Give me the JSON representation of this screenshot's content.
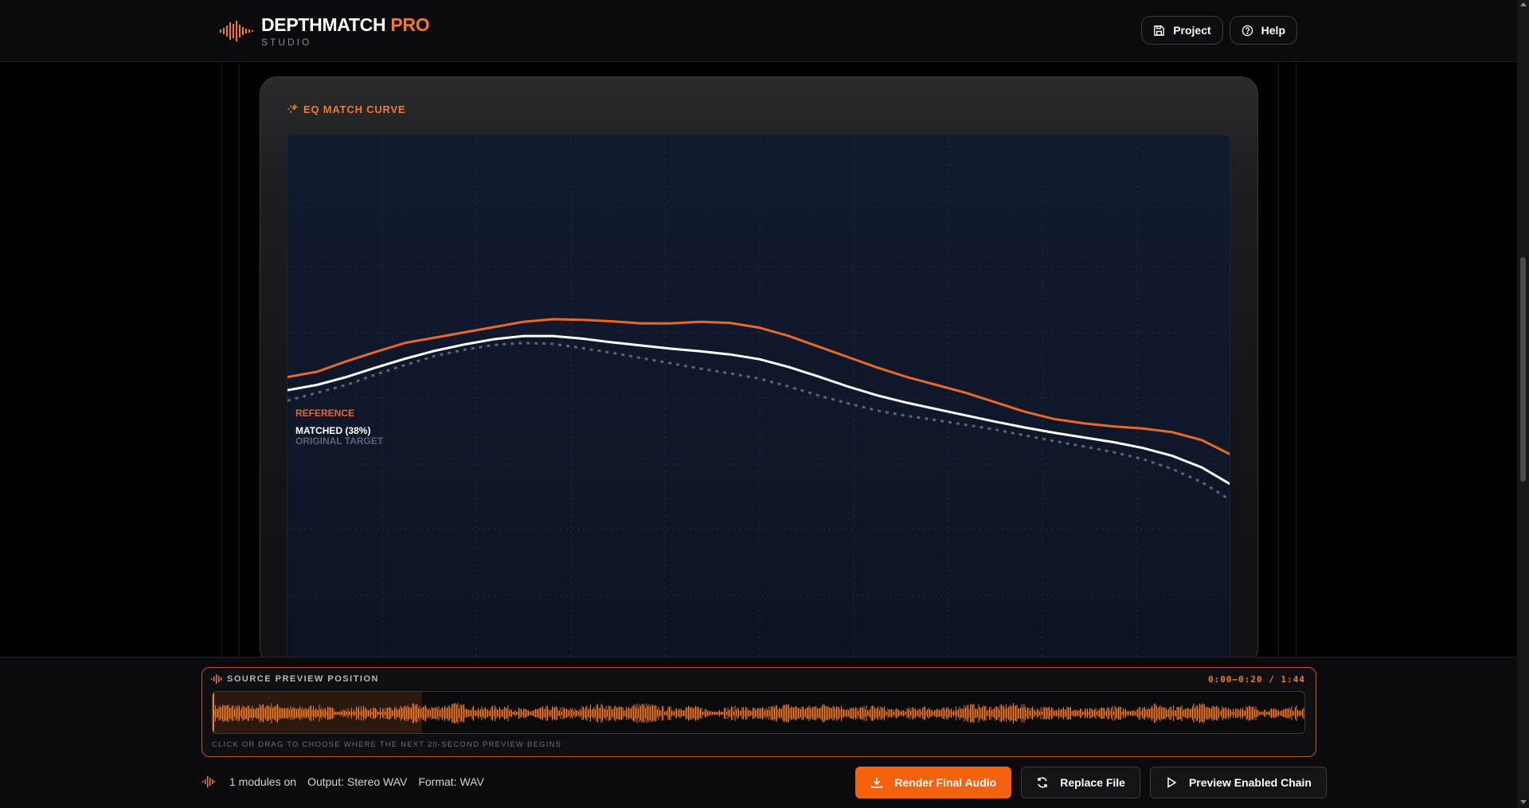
{
  "brand": {
    "title_main": "DEPTHMATCH",
    "title_accent": "PRO",
    "subtitle": "STUDIO"
  },
  "header": {
    "project_label": "Project",
    "help_label": "Help"
  },
  "eq_card": {
    "title": "EQ MATCH CURVE",
    "legend": {
      "reference": "REFERENCE",
      "matched": "MATCHED (38%)",
      "original": "ORIGINAL TARGET"
    }
  },
  "chart_data": {
    "type": "line",
    "title": "",
    "xlabel": "",
    "ylabel": "",
    "grid": true,
    "series": [
      {
        "name": "REFERENCE",
        "values": [
          0.54,
          0.55,
          0.57,
          0.588,
          0.605,
          0.615,
          0.625,
          0.635,
          0.645,
          0.65,
          0.649,
          0.646,
          0.642,
          0.642,
          0.645,
          0.643,
          0.634,
          0.618,
          0.598,
          0.578,
          0.558,
          0.54,
          0.525,
          0.51,
          0.492,
          0.474,
          0.46,
          0.452,
          0.446,
          0.442,
          0.435,
          0.42,
          0.392
        ]
      },
      {
        "name": "MATCHED (38%)",
        "values": [
          0.515,
          0.525,
          0.54,
          0.558,
          0.575,
          0.59,
          0.602,
          0.612,
          0.618,
          0.618,
          0.613,
          0.606,
          0.6,
          0.594,
          0.589,
          0.583,
          0.574,
          0.559,
          0.541,
          0.522,
          0.505,
          0.491,
          0.479,
          0.467,
          0.455,
          0.444,
          0.434,
          0.425,
          0.416,
          0.405,
          0.39,
          0.368,
          0.335
        ]
      },
      {
        "name": "ORIGINAL TARGET",
        "values": [
          0.495,
          0.51,
          0.525,
          0.545,
          0.563,
          0.58,
          0.592,
          0.601,
          0.605,
          0.603,
          0.595,
          0.586,
          0.576,
          0.566,
          0.556,
          0.547,
          0.537,
          0.522,
          0.505,
          0.49,
          0.476,
          0.466,
          0.458,
          0.449,
          0.44,
          0.429,
          0.418,
          0.408,
          0.397,
          0.384,
          0.365,
          0.34,
          0.305
        ]
      }
    ],
    "ylim": [
      0,
      1
    ]
  },
  "preview": {
    "label": "SOURCE PREVIEW POSITION",
    "time": "0:00–0:20 / 1:44",
    "selection_fraction": 0.192,
    "hint": "CLICK OR DRAG TO CHOOSE WHERE THE NEXT 20-SECOND PREVIEW BEGINS"
  },
  "status": {
    "modules": "1 modules on",
    "output": "Output: Stereo WAV",
    "format": "Format: WAV"
  },
  "actions": {
    "render": "Render Final Audio",
    "replace": "Replace File",
    "preview": "Preview Enabled Chain"
  },
  "colors": {
    "accent": "#f47a2a",
    "reference_line": "#e9692a",
    "matched_line": "#ffffff",
    "original_line": "#5b6477"
  }
}
